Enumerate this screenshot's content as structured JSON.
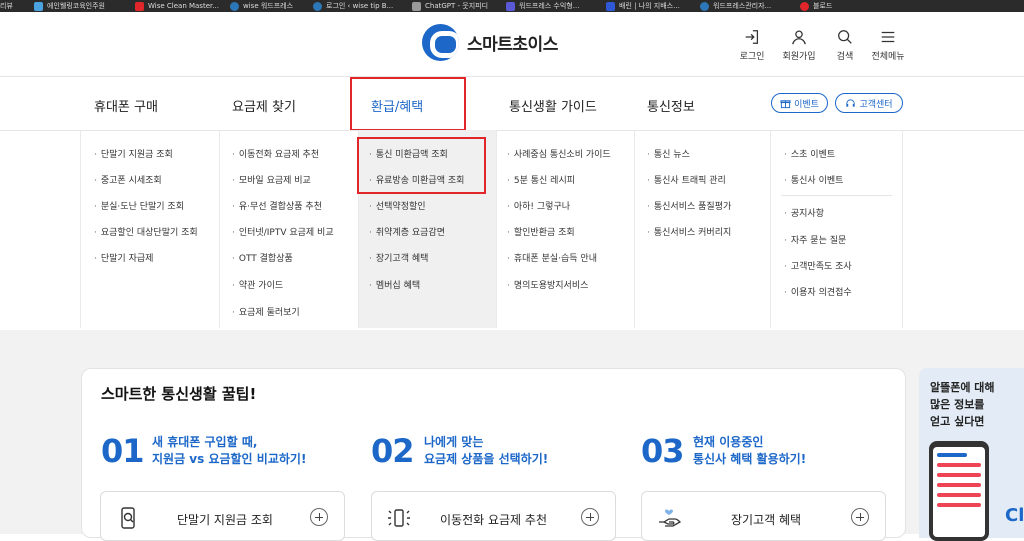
{
  "bookmarks": [
    {
      "label": "리뷰",
      "color": "#888888"
    },
    {
      "label": "에인웰링코육인주원",
      "color": "#4aa3df"
    },
    {
      "label": "Wise Clean Master...",
      "color": "#e0262b"
    },
    {
      "label": "wise 워드프레스",
      "color": "#2c77b8"
    },
    {
      "label": "로그인 ‹ wise tip B...",
      "color": "#2c77b8"
    },
    {
      "label": "ChatGPT - 웃지피디",
      "color": "#9a9a9a"
    },
    {
      "label": "워드프레스 수익형...",
      "color": "#5a5ad6"
    },
    {
      "label": "배린 | 나의 지배스...",
      "color": "#2f58d6"
    },
    {
      "label": "워드프레스관리자...",
      "color": "#2c77b8"
    },
    {
      "label": "블로드",
      "color": "#e0262b"
    }
  ],
  "header": {
    "logo_text": "스마트초이스",
    "utils": [
      {
        "label": "로그인",
        "icon": "login-icon"
      },
      {
        "label": "회원가입",
        "icon": "person-icon"
      },
      {
        "label": "검색",
        "icon": "search-icon"
      },
      {
        "label": "전체메뉴",
        "icon": "menu-icon"
      }
    ]
  },
  "nav": {
    "items": [
      "휴대폰 구매",
      "요금제 찾기",
      "환급/혜택",
      "통신생활 가이드",
      "통신정보"
    ],
    "active_index": 2,
    "event_label": "이벤트",
    "support_label": "고객센터"
  },
  "menu": {
    "col1": [
      "단말기 지원금 조회",
      "중고폰 시세조회",
      "분실·도난 단말기 조회",
      "요금할인 대상단말기 조회",
      "단말기 자급제"
    ],
    "col2": [
      "이동전화 요금제 추천",
      "모바일 요금제 비교",
      "유·무선 결합상품 추천",
      "인터넷/IPTV 요금제 비교",
      "OTT 결합상품",
      "약관 가이드",
      "요금제 둘러보기"
    ],
    "col3": [
      "통신 미환급액 조회",
      "유료방송 미환급액 조회",
      "선택약정할인",
      "취약계층 요금감면",
      "장기고객 혜택",
      "멤버십 혜택"
    ],
    "col4": [
      "사례중심 통신소비 가이드",
      "5분 통신 레시피",
      "아하! 그렇구나",
      "할인반환금 조회",
      "휴대폰 분실·습득 안내",
      "명의도용방지서비스"
    ],
    "col5": [
      "통신 뉴스",
      "통신사 트래픽 관리",
      "통신서비스 품질평가",
      "통신서비스 커버리지"
    ],
    "col6a": [
      "스초 이벤트",
      "통신사 이벤트"
    ],
    "col6b": [
      "공지사항",
      "자주 묻는 질문",
      "고객만족도 조사",
      "이용자 의견접수"
    ]
  },
  "tips": {
    "title": "스마트한 통신생활 꿀팁!",
    "items": [
      {
        "num": "01",
        "line1": "새 휴대폰 구입할 때,",
        "line2": "지원금 vs 요금할인 비교하기!",
        "service": "단말기 지원금 조회",
        "icon": "phone-search-icon"
      },
      {
        "num": "02",
        "line1": "나에게 맞는",
        "line2": "요금제 상품을 선택하기!",
        "service": "이동전화 요금제 추천",
        "icon": "phone-signal-icon"
      },
      {
        "num": "03",
        "line1": "현재 이용중인",
        "line2": "통신사 혜택 활용하기!",
        "service": "장기고객 혜택",
        "icon": "hand-heart-icon"
      }
    ]
  },
  "side_banner": {
    "line1": "알뜰폰에 대해",
    "line2": "많은 정보를",
    "line3": "얻고 싶다면",
    "logo_partial": "Cl"
  },
  "colors": {
    "brand": "#1c67c8",
    "highlight": "#e0262b"
  }
}
